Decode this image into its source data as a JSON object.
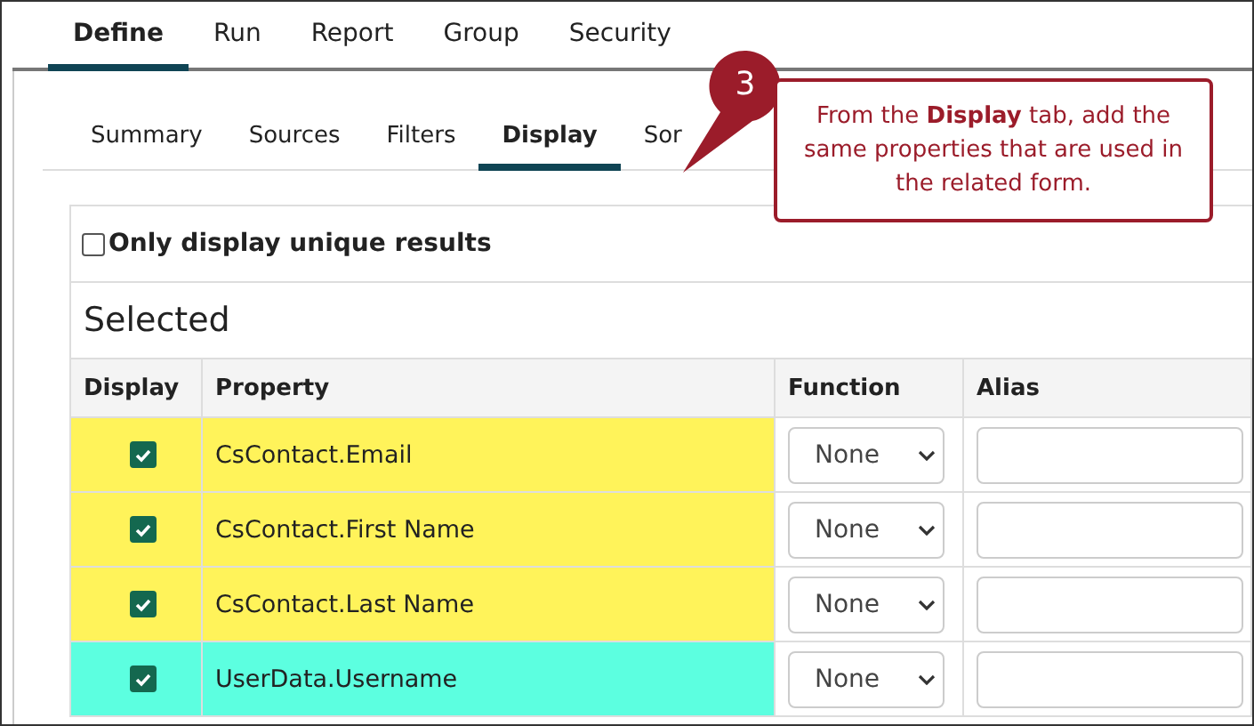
{
  "main_tabs": [
    {
      "label": "Define",
      "selected": true
    },
    {
      "label": "Run",
      "selected": false
    },
    {
      "label": "Report",
      "selected": false
    },
    {
      "label": "Group",
      "selected": false
    },
    {
      "label": "Security",
      "selected": false
    }
  ],
  "sub_tabs": [
    {
      "label": "Summary",
      "selected": false
    },
    {
      "label": "Sources",
      "selected": false
    },
    {
      "label": "Filters",
      "selected": false
    },
    {
      "label": "Display",
      "selected": true
    },
    {
      "label": "Sor",
      "selected": false
    }
  ],
  "unique_results": {
    "label": "Only display unique results",
    "checked": false
  },
  "section_title": "Selected",
  "table": {
    "columns": [
      "Display",
      "Property",
      "Function",
      "Alias"
    ],
    "rows": [
      {
        "checked": true,
        "property": "CsContact.Email",
        "function": "None",
        "color": "#fff35a"
      },
      {
        "checked": true,
        "property": "CsContact.First Name",
        "function": "None",
        "color": "#fff35a"
      },
      {
        "checked": true,
        "property": "CsContact.Last Name",
        "function": "None",
        "color": "#fff35a"
      },
      {
        "checked": true,
        "property": "UserData.Username",
        "function": "None",
        "color": "#5cffe0"
      }
    ]
  },
  "callout": {
    "step": "3",
    "text": "From the **Display** tab, add the same properties that are used in the related form."
  }
}
